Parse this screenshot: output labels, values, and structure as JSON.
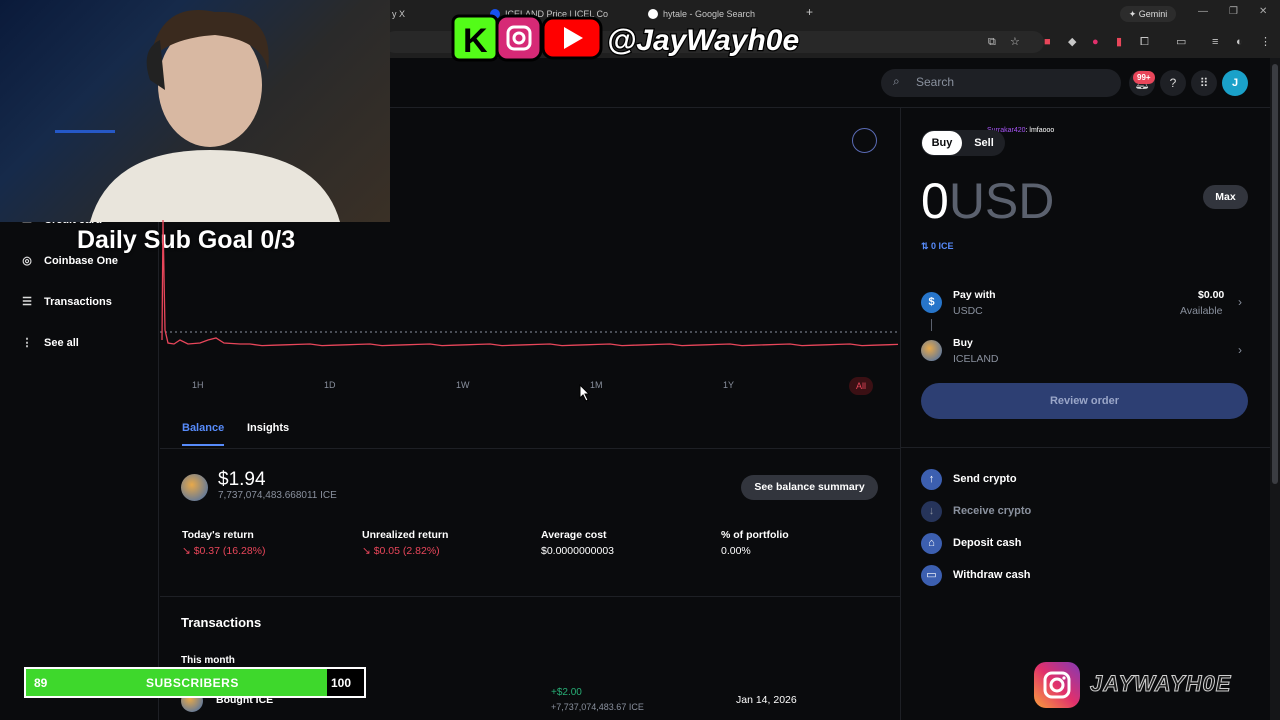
{
  "browser": {
    "tabs": [
      {
        "label": "y X"
      },
      {
        "label": "ICELAND Price | ICEL Co"
      },
      {
        "label": "hytale - Google Search"
      }
    ],
    "new_tab": "+",
    "gemini": "Gemini"
  },
  "header": {
    "search_placeholder": "Search",
    "notifications_badge": "99+",
    "help": "?",
    "avatar_initial": "J"
  },
  "sidebar": {
    "items": [
      {
        "label": "Credit card",
        "icon": "card-icon"
      },
      {
        "label": "Coinbase One",
        "icon": "coinbase-one-icon"
      },
      {
        "label": "Transactions",
        "icon": "transactions-icon"
      },
      {
        "label": "See all",
        "icon": "more-vertical-icon"
      }
    ]
  },
  "overlay": {
    "banner_handle": "@JayWayh0e",
    "sub_goal": "Daily Sub Goal 0/3",
    "subscribers": {
      "current": "89",
      "label": "SUBSCRIBERS",
      "target": "100",
      "progress": 0.89
    },
    "instagram_handle": "JAYWAYH0E",
    "chat_user": "Surrakar420",
    "chat_msg": ": lmfaooo"
  },
  "chart": {
    "ranges": [
      "1H",
      "1D",
      "1W",
      "1M",
      "1Y",
      "All"
    ],
    "selected_range": "All"
  },
  "asset": {
    "tabs": [
      "Balance",
      "Insights"
    ],
    "balance_usd": "$1.94",
    "balance_ice": "7,737,074,483.668011 ICE",
    "summary_button": "See balance summary",
    "stats": [
      {
        "label": "Today's return",
        "value": "↘ $0.37 (16.28%)",
        "negative": true
      },
      {
        "label": "Unrealized return",
        "value": "↘ $0.05 (2.82%)",
        "negative": true
      },
      {
        "label": "Average cost",
        "value": "$0.0000000003",
        "negative": false
      },
      {
        "label": "% of portfolio",
        "value": "0.00%",
        "negative": false
      }
    ]
  },
  "transactions": {
    "title": "Transactions",
    "period": "This month",
    "rows": [
      {
        "name": "Bought ICE",
        "usd": "+$2.00",
        "ice": "+7,737,074,483.67 ICE",
        "date": "Jan 14, 2026"
      }
    ]
  },
  "trade": {
    "buy": "Buy",
    "sell": "Sell",
    "amount": "0",
    "currency": "USD",
    "max": "Max",
    "ice_amount": "0 ICE",
    "pay_title": "Pay with",
    "pay_asset": "USDC",
    "pay_balance": "$0.00",
    "pay_available": "Available",
    "buy_title": "Buy",
    "buy_asset": "ICELAND",
    "review": "Review order"
  },
  "actions": [
    {
      "label": "Send crypto",
      "icon": "arrow-up-icon",
      "enabled": true
    },
    {
      "label": "Receive crypto",
      "icon": "arrow-down-icon",
      "enabled": false
    },
    {
      "label": "Deposit cash",
      "icon": "bank-icon",
      "enabled": true
    },
    {
      "label": "Withdraw cash",
      "icon": "cash-icon",
      "enabled": true
    }
  ],
  "colors": {
    "accent": "#578bfa",
    "negative": "#e8465a",
    "positive": "#27ad75",
    "chart_line": "#e8465a"
  }
}
